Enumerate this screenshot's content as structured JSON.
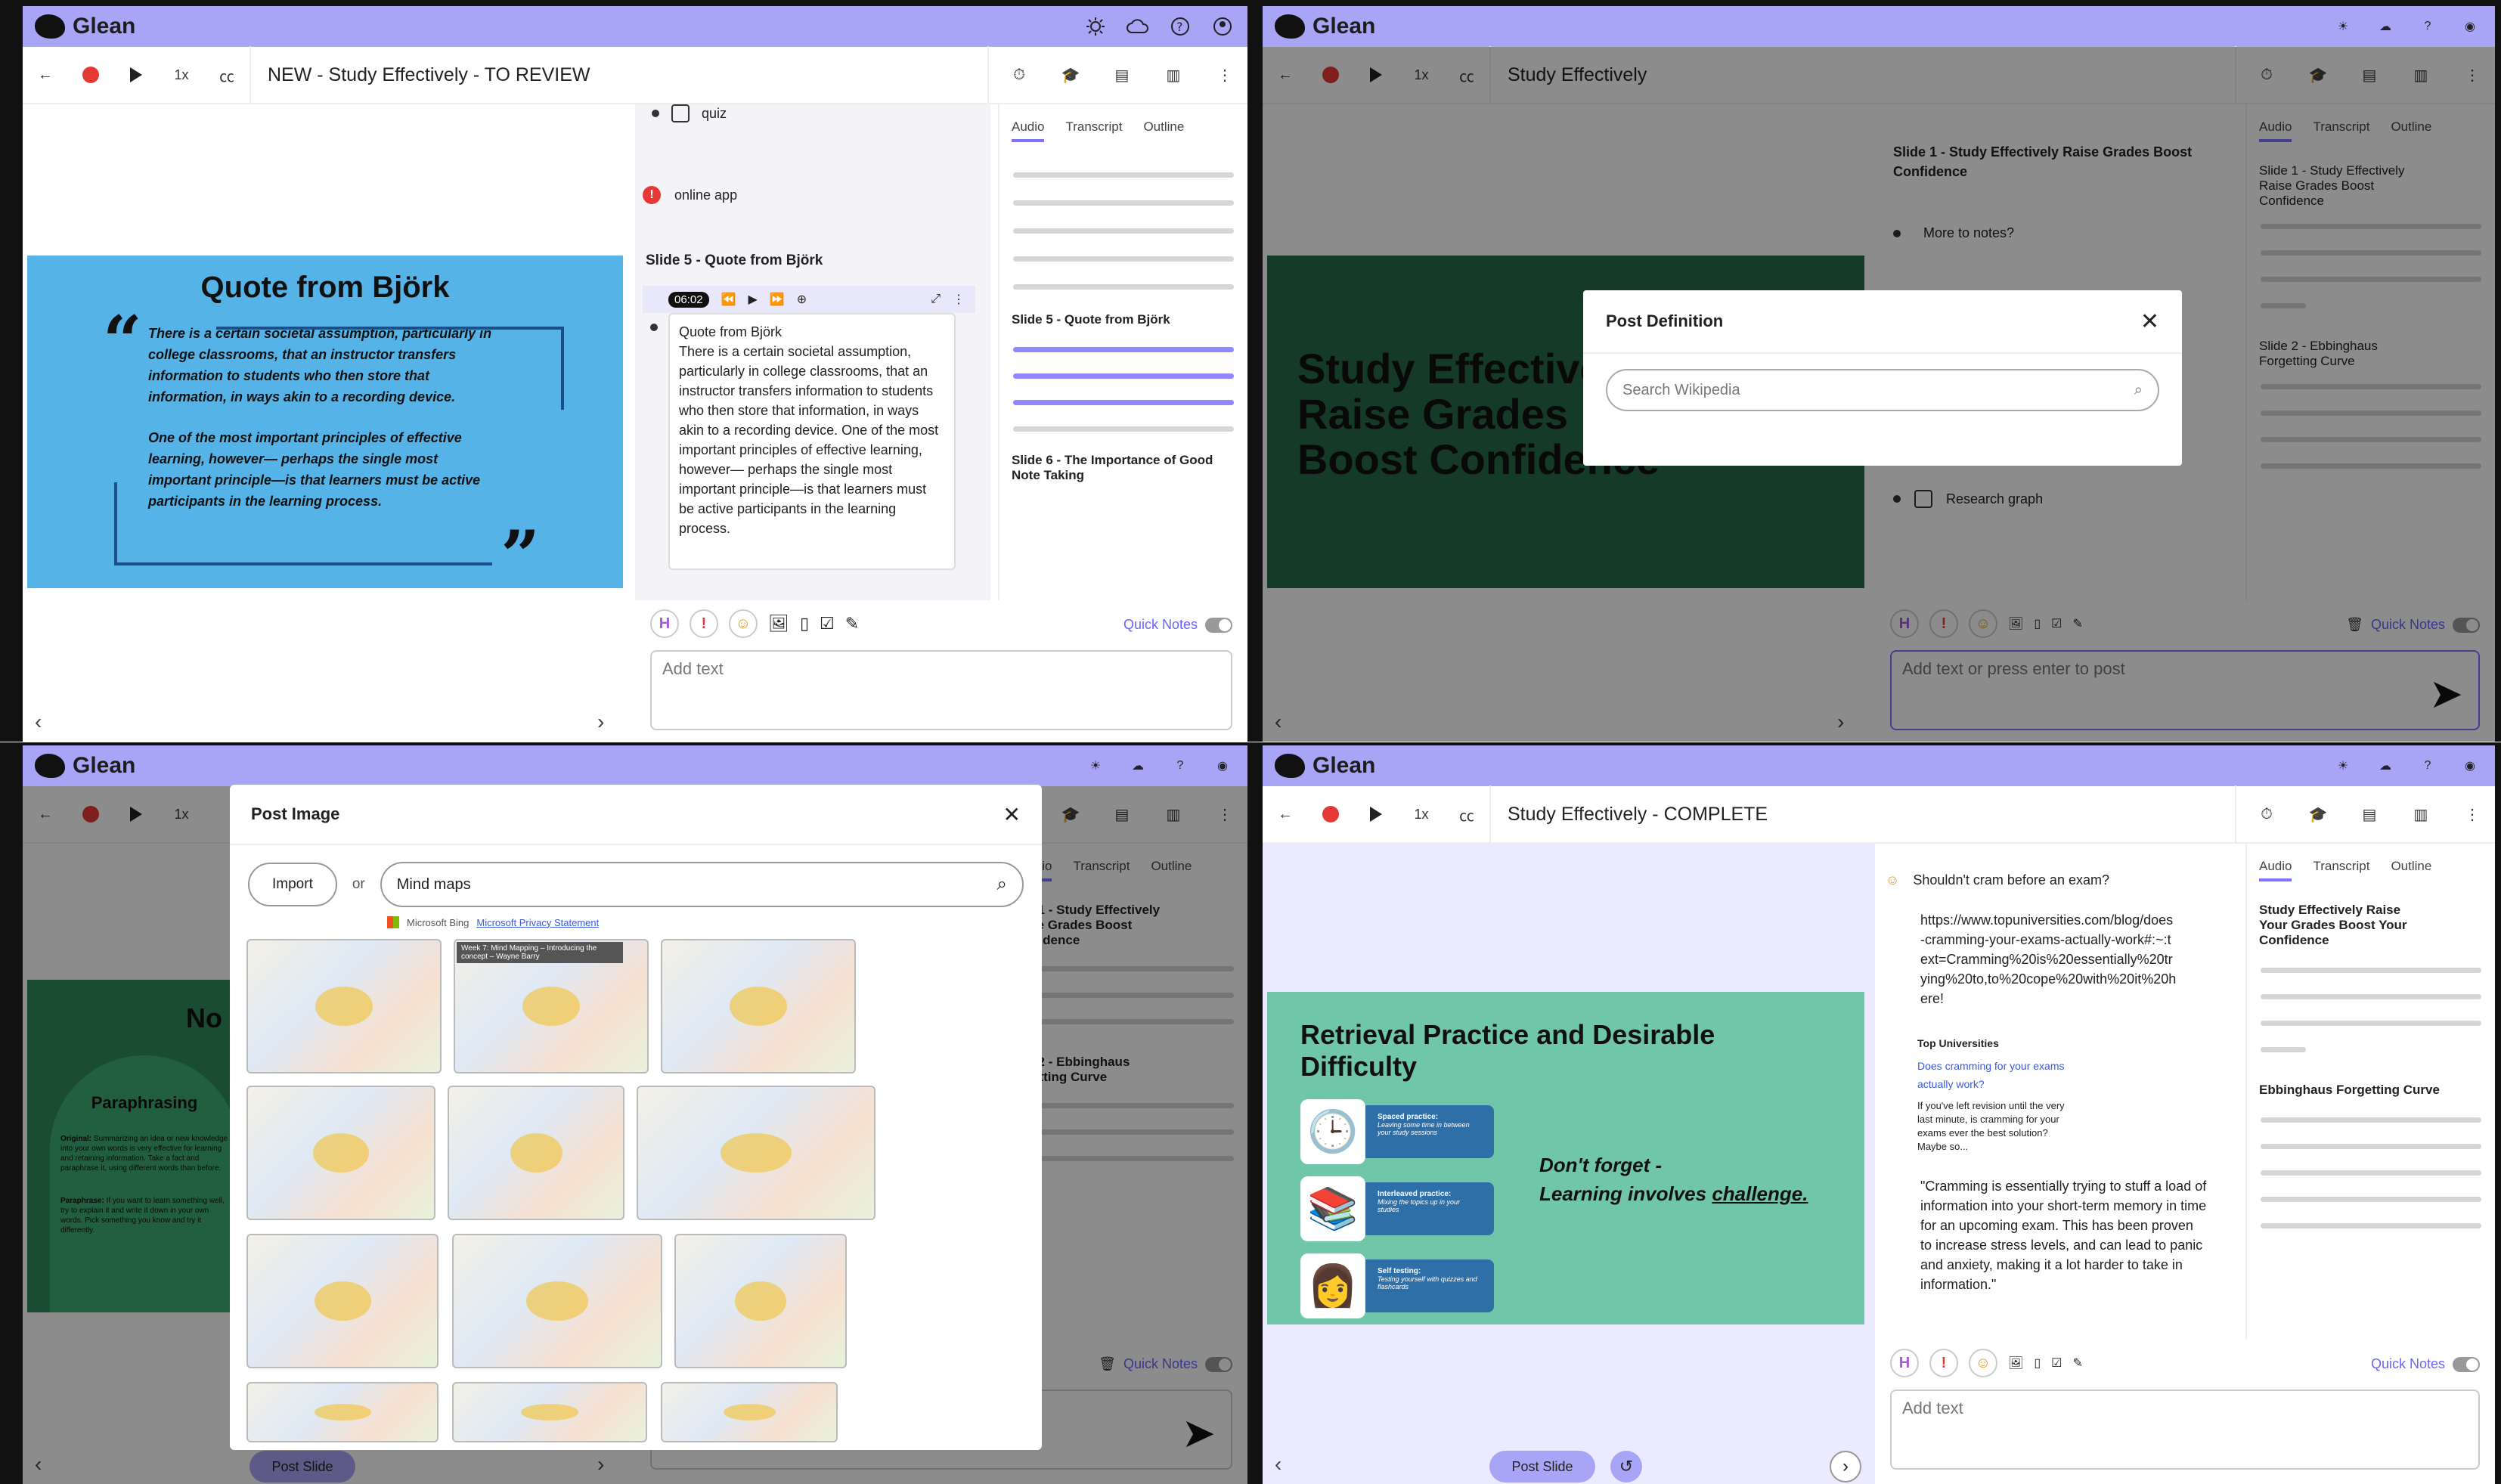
{
  "app": {
    "name": "Glean"
  },
  "pane1": {
    "title": "NEW - Study Effectively - TO REVIEW",
    "speed": "1x",
    "slide": {
      "heading": "Quote from Björk",
      "para1": "There is a certain societal assumption, particularly in college classrooms, that an instructor transfers information to students who then store that information, in ways akin to a recording device.",
      "para2": "One of the most important principles of effective learning, however— perhaps the single most important principle—is that learners must be active participants in the learning process."
    },
    "notes": {
      "quiz": "quiz",
      "online_app": "online app",
      "section": "Slide 5 - Quote from Björk",
      "timestamp": "06:02",
      "note_title": "Quote from Björk",
      "note_body": "There is a certain societal assumption, particularly in college classrooms, that an instructor transfers information to students who then store that information, in ways akin to a recording device. One of the most important principles of effective learning, however— perhaps the single most important principle—is that learners must be active participants in the learning process."
    },
    "tabs": [
      "Audio",
      "Transcript",
      "Outline"
    ],
    "outline": [
      "Slide 5 - Quote from Björk",
      "Slide 6 - The Importance of Good Note Taking"
    ],
    "quick_notes": "Quick Notes",
    "add_text": "Add text"
  },
  "pane2": {
    "title": "Study Effectively",
    "speed": "1x",
    "slide_text": [
      "Study Effective",
      "Raise Grades",
      "Boost Confidence"
    ],
    "notes": [
      "Slide 1 - Study Effectively Raise Grades Boost Confidence",
      "More to notes?",
      "Research graph"
    ],
    "tabs": [
      "Audio",
      "Transcript",
      "Outline"
    ],
    "outline": [
      "Slide 1 - Study Effectively Raise Grades Boost Confidence",
      "Slide 2 - Ebbinghaus Forgetting Curve"
    ],
    "modal": {
      "title": "Post Definition",
      "placeholder": "Search Wikipedia"
    },
    "quick_notes": "Quick Notes",
    "add_text": "Add text or press enter to post"
  },
  "pane3": {
    "speed": "1x",
    "slide": {
      "partial": "No",
      "heading": "Paraphrasing",
      "original_label": "Original:",
      "original": "Summarizing an idea or new knowledge into your own words is very effective for learning and retaining information. Take a fact and paraphrase it, using different words than before.",
      "paraphrase_label": "Paraphrase:",
      "paraphrase": "If you want to learn something well, try to explain it and write it down in your own words. Pick something you know and try it differently."
    },
    "tabs": [
      "Audio",
      "Transcript",
      "Outline"
    ],
    "outline": [
      "de 1 - Study Effectively aise Grades Boost onfidence",
      "de 2 - Ebbinghaus rgetting Curve"
    ],
    "modal": {
      "title": "Post Image",
      "import": "Import",
      "or": "or",
      "search_value": "Mind maps",
      "bing": "Microsoft Bing",
      "privacy": "Microsoft Privacy Statement",
      "tooltip": "Week 7: Mind Mapping – Introducing the concept – Wayne Barry"
    },
    "quick_notes": "Quick Notes",
    "post_slide": "Post Slide"
  },
  "pane4": {
    "title": "Study Effectively - COMPLETE",
    "speed": "1x",
    "slide": {
      "heading": "Retrieval Practice and Desirable Difficulty",
      "items": [
        {
          "title": "Spaced practice:",
          "desc": "Leaving some time in between your study sessions"
        },
        {
          "title": "Interleaved practice:",
          "desc": "Mixing the topics up in your studies"
        },
        {
          "title": "Self testing:",
          "desc": "Testing yourself with quizzes and flashcards"
        }
      ],
      "reminder1": "Don't forget -",
      "reminder2": "Learning involves",
      "reminder_link": "challenge."
    },
    "notes": {
      "question": "Shouldn't cram before an exam?",
      "url": "https://www.topuniversities.com/blog/does-cramming-your-exams-actually-work#:~:text=Cramming%20is%20essentially%20trying%20to,to%20cope%20with%20it%20here!",
      "source": "Top Universities",
      "link": "Does cramming for your exams actually work?",
      "snippet": "If you've left revision until the very last minute, is cramming for your exams ever the best solution? Maybe so...",
      "quote": "\"Cramming is essentially trying to stuff a load of information into your short-term memory in time for an upcoming exam. This has been proven to increase stress levels, and can lead to panic and anxiety, making it a lot harder to take in information.\""
    },
    "tabs": [
      "Audio",
      "Transcript",
      "Outline"
    ],
    "outline": [
      "Study Effectively Raise Your Grades Boost Your Confidence",
      "Ebbinghaus Forgetting Curve"
    ],
    "quick_notes": "Quick Notes",
    "add_text": "Add text",
    "post_slide": "Post Slide"
  },
  "colors": {
    "titlebar": "#a9a5f6",
    "accent": "#6b63ff",
    "record": "#e53935",
    "slide_blue": "#56b3e8",
    "slide_green": "#276a4a",
    "slide_teal": "#6fc6a8"
  }
}
